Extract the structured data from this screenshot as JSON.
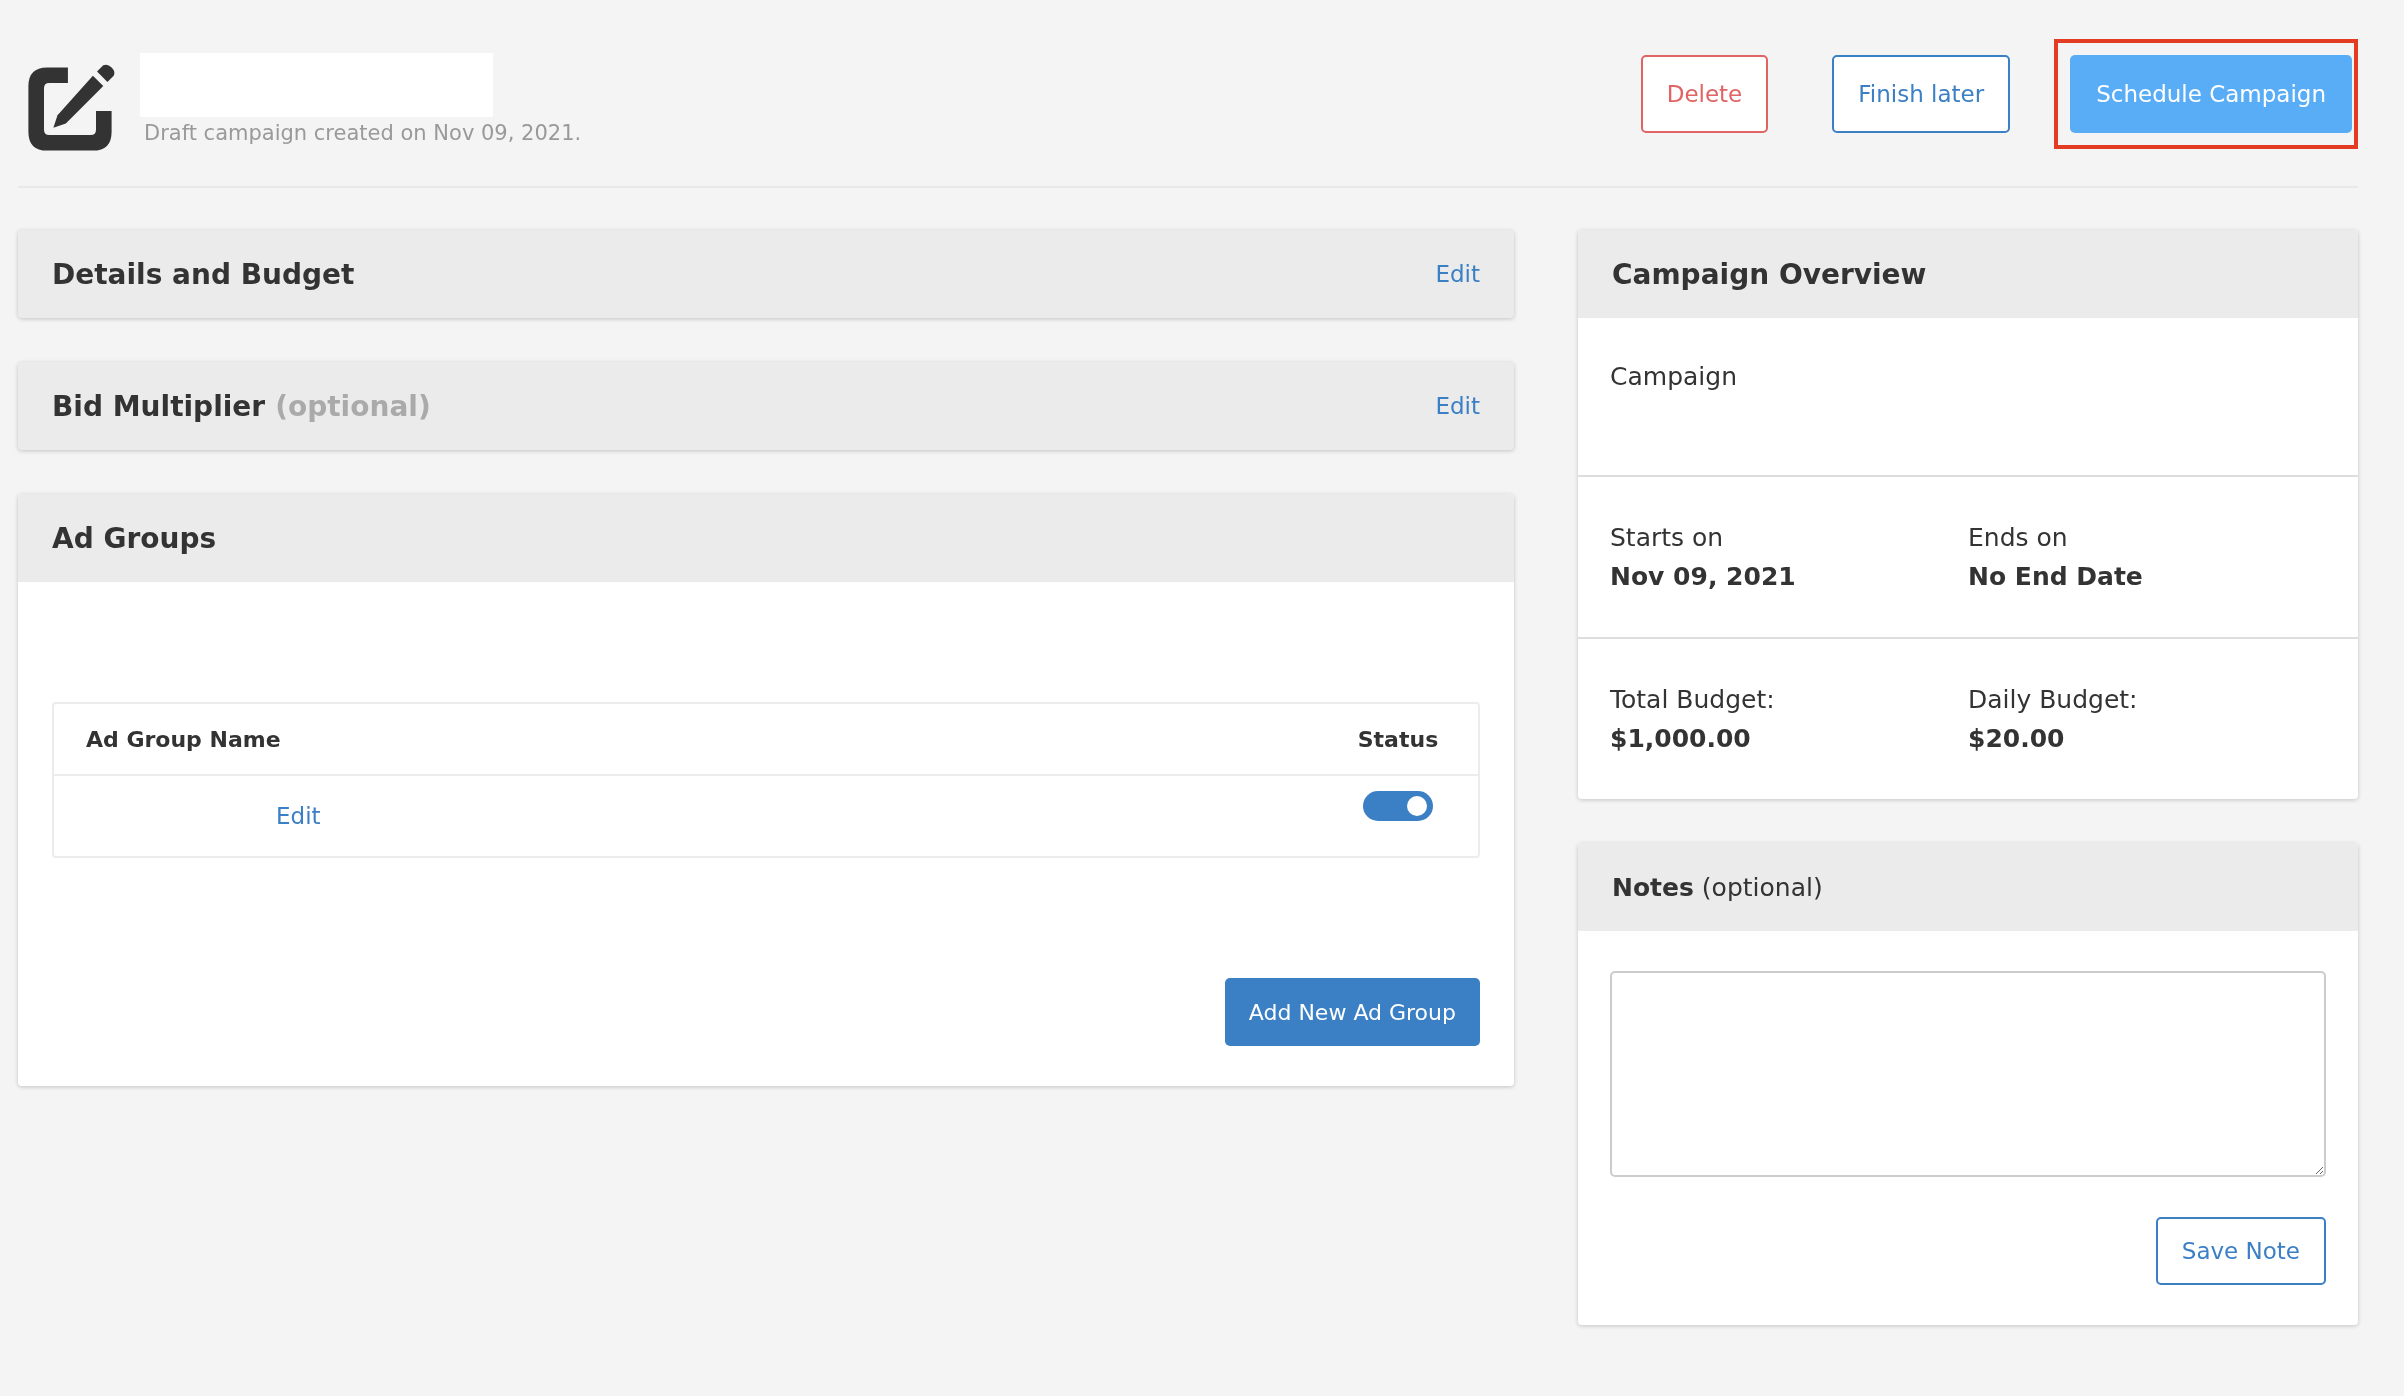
{
  "header": {
    "subtitle": "Draft campaign created on Nov 09, 2021.",
    "buttons": [
      {
        "label": "Delete",
        "kind": "danger",
        "highlighted": false
      },
      {
        "label": "Finish later",
        "kind": "outline",
        "highlighted": false
      },
      {
        "label": "Schedule Campaign",
        "kind": "primary",
        "highlighted": true
      }
    ]
  },
  "panels": [
    {
      "title": "Details and Budget",
      "action": "Edit"
    },
    {
      "title": "Bid Multiplier",
      "suffix": "(optional)",
      "action": "Edit"
    }
  ],
  "ad_groups": {
    "title": "Ad Groups",
    "columns": [
      "Ad Group Name",
      "Status"
    ],
    "rows": [
      {
        "name_link": "Edit",
        "on": true
      }
    ],
    "add_button": "Add New Ad Group"
  },
  "overview": {
    "title": "Campaign Overview",
    "campaign_label": "Campaign",
    "pairs": [
      [
        {
          "label": "Starts on",
          "value": "Nov 09, 2021"
        },
        {
          "label": "Ends on",
          "value": "No End Date"
        }
      ],
      [
        {
          "label": "Total Budget:",
          "value": "$1,000.00"
        },
        {
          "label": "Daily Budget:",
          "value": "$20.00"
        }
      ]
    ]
  },
  "notes": {
    "title": "**Notes** (optional)",
    "button": "Save Note"
  }
}
